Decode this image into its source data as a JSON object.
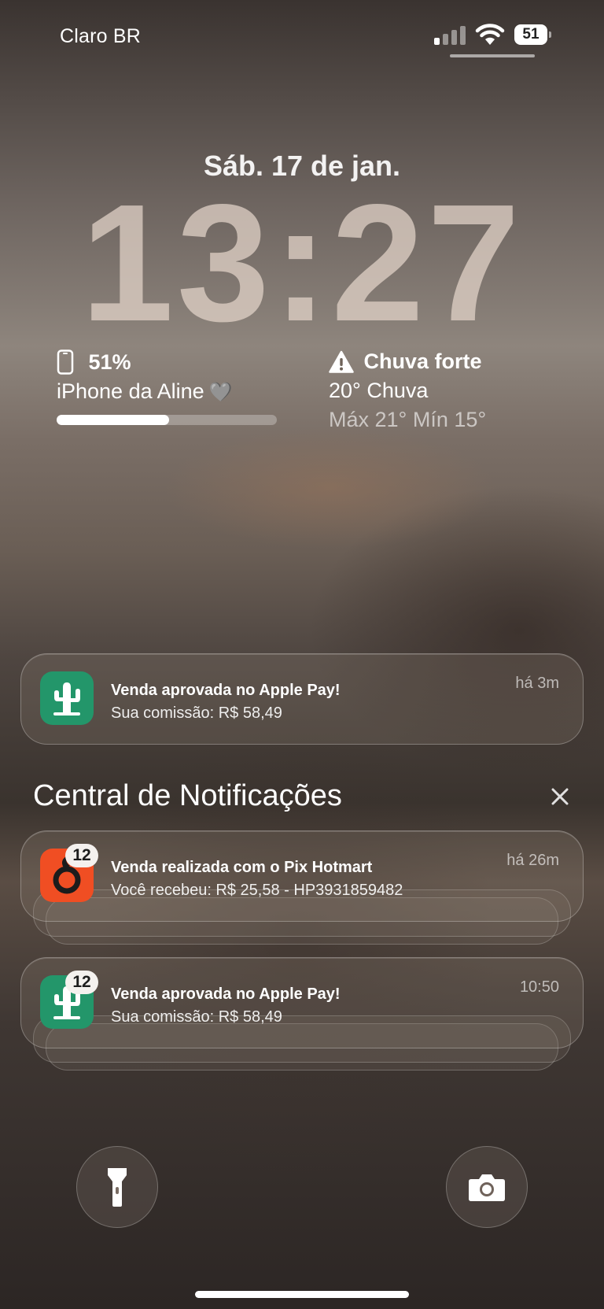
{
  "status_bar": {
    "carrier": "Claro BR",
    "signal_bars_active": 1,
    "signal_bars_total": 4,
    "battery_level": "51"
  },
  "lock_screen": {
    "date": "Sáb. 17 de jan.",
    "time": "13:27"
  },
  "battery_widget": {
    "percent": "51%",
    "device_name": "iPhone da Aline",
    "heart": "🩶",
    "level": 0.51
  },
  "weather_widget": {
    "alert": "Chuva forte",
    "condition": "20° Chuva",
    "range": "Máx 21° Mín 15°"
  },
  "notification_center": {
    "title": "Central de Notificações"
  },
  "notifications": [
    {
      "title": "Venda aprovada no Apple Pay!",
      "body": "Sua comissão: R$ 58,49",
      "time": "há 3m",
      "icon": "cactus-icon"
    },
    {
      "title": "Venda realizada com o Pix Hotmart",
      "body": "Você recebeu: R$ 25,58 - HP3931859482",
      "time": "há 26m",
      "badge": "12",
      "icon": "hotmart-icon"
    },
    {
      "title": "Venda aprovada no Apple Pay!",
      "body": "Sua comissão: R$ 58,49",
      "time": "10:50",
      "badge": "12",
      "icon": "cactus-icon"
    }
  ],
  "colors": {
    "cactus_app": "#23966a",
    "hotmart_app": "#f04e23"
  }
}
